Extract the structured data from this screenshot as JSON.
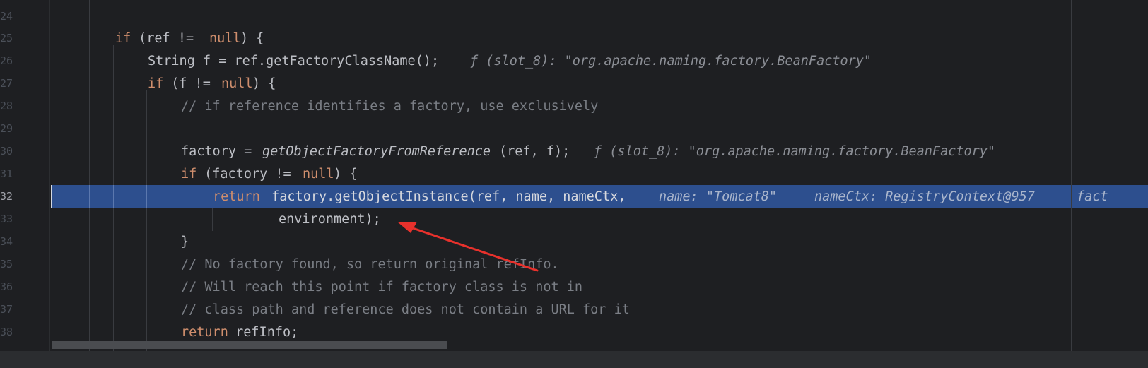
{
  "editor": {
    "line_numbers": [
      "24",
      "25",
      "26",
      "27",
      "28",
      "29",
      "30",
      "31",
      "32",
      "33",
      "34",
      "35",
      "36",
      "37",
      "38"
    ],
    "lines": {
      "l23_partial": "",
      "l25_kw": "if",
      "l25_rest": " (ref != ",
      "l25_null": "null",
      "l25_end": ") {",
      "l26_code": "String f = ref.getFactoryClassName();",
      "l26_hint": "ƒ (slot_8): \"org.apache.naming.factory.BeanFactory\"",
      "l27_kw": "if",
      "l27_rest": " (f != ",
      "l27_null": "null",
      "l27_end": ") {",
      "l28_comment": "// if reference identifies a factory, use exclusively",
      "l30_a": "factory = ",
      "l30_fn": "getObjectFactoryFromReference",
      "l30_b": "(ref, f);",
      "l30_hint": "ƒ (slot_8): \"org.apache.naming.factory.BeanFactory\"",
      "l31_kw": "if",
      "l31_rest": " (factory != ",
      "l31_null": "null",
      "l31_end": ") {",
      "l32_kw": "return",
      "l32_code": " factory.getObjectInstance(ref, name, nameCtx,",
      "l32_hint1": "name: \"Tomcat8\"",
      "l32_hint2": "nameCtx: RegistryContext@957",
      "l32_hint3": "fact",
      "l33_code": "environment);",
      "l34_code": "}",
      "l35_comment": "// No factory found, so return original refInfo.",
      "l36_comment": "// Will reach this point if factory class is not in",
      "l37_comment": "// class path and reference does not contain a URL for it",
      "l38_kw": "return",
      "l38_code": " refInfo;"
    }
  },
  "colors": {
    "background": "#1e1f22",
    "keyword": "#cf8e6d",
    "comment": "#7a7e85",
    "execution_line": "#2d4f8e",
    "annotation_arrow": "#e8312c"
  },
  "annotation": {
    "icon": "red-arrow-icon"
  }
}
